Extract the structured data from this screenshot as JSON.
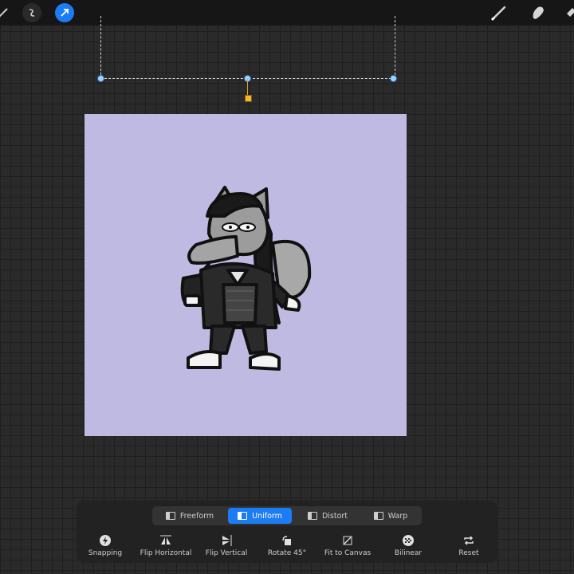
{
  "transform_modes": [
    {
      "label": "Freeform",
      "icon": "freeform-icon",
      "active": false
    },
    {
      "label": "Uniform",
      "icon": "uniform-icon",
      "active": true
    },
    {
      "label": "Distort",
      "icon": "distort-icon",
      "active": false
    },
    {
      "label": "Warp",
      "icon": "warp-icon",
      "active": false
    }
  ],
  "tools": [
    {
      "label": "Snapping",
      "icon": "snapping-icon"
    },
    {
      "label": "Flip Horizontal",
      "icon": "flip-horizontal-icon"
    },
    {
      "label": "Flip Vertical",
      "icon": "flip-vertical-icon"
    },
    {
      "label": "Rotate 45°",
      "icon": "rotate-45-icon"
    },
    {
      "label": "Fit to Canvas",
      "icon": "fit-to-canvas-icon"
    },
    {
      "label": "Bilinear",
      "icon": "bilinear-icon"
    },
    {
      "label": "Reset",
      "icon": "reset-icon"
    }
  ],
  "topbar": {
    "left_icons": [
      "adjustments-icon",
      "selection-icon",
      "transform-arrow-icon"
    ],
    "right_icons": [
      "brush-icon",
      "smudge-icon",
      "eraser-icon"
    ]
  },
  "colors": {
    "accent": "#1b7cf4",
    "canvas": "#bfbae2"
  }
}
